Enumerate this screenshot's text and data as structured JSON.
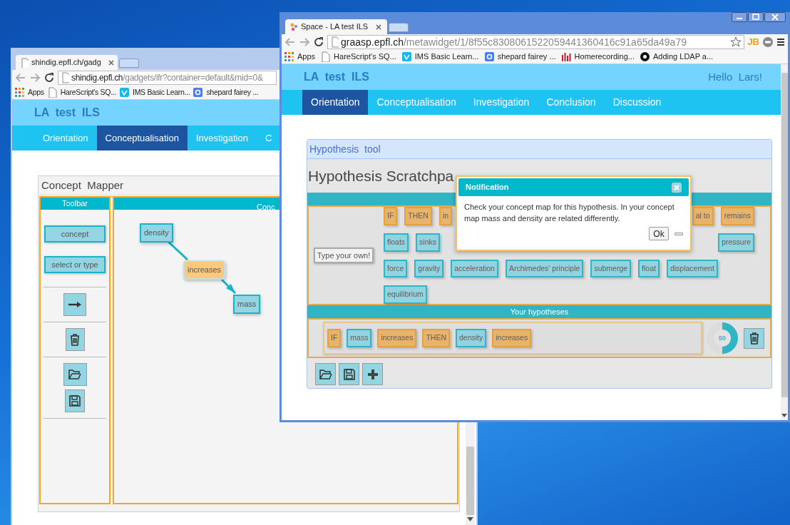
{
  "left_window": {
    "tab_title": "shindig.epfl.ch/gadg",
    "address_host": "shindig.epfl.ch",
    "address_path": "/gadgets/ifr?container=default&mid=0&",
    "bookmarks": [
      "Apps",
      "HareScript's SQ...",
      "IMS Basic Learn...",
      "shepard fairey ..."
    ],
    "site_title": "LA  test  ILS",
    "nav": [
      {
        "label": "Orientation",
        "selected": false
      },
      {
        "label": "Conceptualisation",
        "selected": true
      },
      {
        "label": "Investigation",
        "selected": false
      },
      {
        "label": "C",
        "selected": false
      }
    ],
    "concept_mapper": {
      "title": "Concept  Mapper",
      "toolbar_title": "Toolbar",
      "toolbar_buttons": [
        "concept",
        "select or type"
      ],
      "canvas_title": "Conc",
      "nodes": [
        {
          "kind": "concept",
          "label": "density"
        },
        {
          "kind": "relation",
          "label": "increases"
        },
        {
          "kind": "concept",
          "label": "mass"
        }
      ]
    }
  },
  "right_window": {
    "tab_title": "Space - LA test ILS",
    "address_host": "graasp.epfl.ch",
    "address_path": "/metawidget/1/8f55c8308061522059441360416c91a65da49a79",
    "extension_label": "JB",
    "bookmarks": [
      "Apps",
      "HareScript's SQ...",
      "IMS Basic Learn...",
      "shepard fairey ...",
      "Homerecording...",
      "Adding LDAP a..."
    ],
    "site_title": "LA  test  ILS",
    "greeting": "Hello  Lars!",
    "nav": [
      {
        "label": "Orientation",
        "selected": true
      },
      {
        "label": "Conceptualisation",
        "selected": false
      },
      {
        "label": "Investigation",
        "selected": false
      },
      {
        "label": "Conclusion",
        "selected": false
      },
      {
        "label": "Discussion",
        "selected": false
      }
    ],
    "hypothesis_tool": {
      "title": "Hypothesis  tool",
      "heading": "Hypothesis Scratchpa",
      "type_own_button": "Type your own!",
      "chip_rows": [
        [
          {
            "kind": "relation",
            "label": "IF"
          },
          {
            "kind": "relation",
            "label": "THEN"
          },
          {
            "kind": "relation",
            "label": "in"
          },
          {
            "kind": "gap"
          },
          {
            "kind": "relation",
            "label": "al to"
          },
          {
            "kind": "relation",
            "label": "remains"
          }
        ],
        [
          {
            "kind": "concept",
            "label": "floats"
          },
          {
            "kind": "concept",
            "label": "sinks"
          },
          {
            "kind": "gap"
          },
          {
            "kind": "concept",
            "label": "pressure"
          }
        ],
        [
          {
            "kind": "concept",
            "label": "force"
          },
          {
            "kind": "concept",
            "label": "gravity"
          },
          {
            "kind": "concept",
            "label": "acceleration"
          },
          {
            "kind": "concept",
            "label": "Archimedes' principle"
          },
          {
            "kind": "concept",
            "label": "submerge"
          },
          {
            "kind": "concept",
            "label": "float"
          },
          {
            "kind": "concept",
            "label": "displacement"
          }
        ],
        [
          {
            "kind": "concept",
            "label": "equilibrium"
          }
        ]
      ],
      "hypotheses_title": "Your hypotheses",
      "hypothesis": [
        {
          "kind": "relation",
          "label": "IF"
        },
        {
          "kind": "concept",
          "label": "mass"
        },
        {
          "kind": "relation",
          "label": "increases"
        },
        {
          "kind": "relation",
          "label": "THEN"
        },
        {
          "kind": "concept",
          "label": "density"
        },
        {
          "kind": "relation",
          "label": "increases"
        }
      ],
      "score": {
        "level": 0.5,
        "reading": "50"
      }
    },
    "notification": {
      "title": "Notification",
      "message": "Check your concept map for this hypothesis. In your concept map mass and density are related differently.",
      "ok_label": "Ok"
    }
  }
}
